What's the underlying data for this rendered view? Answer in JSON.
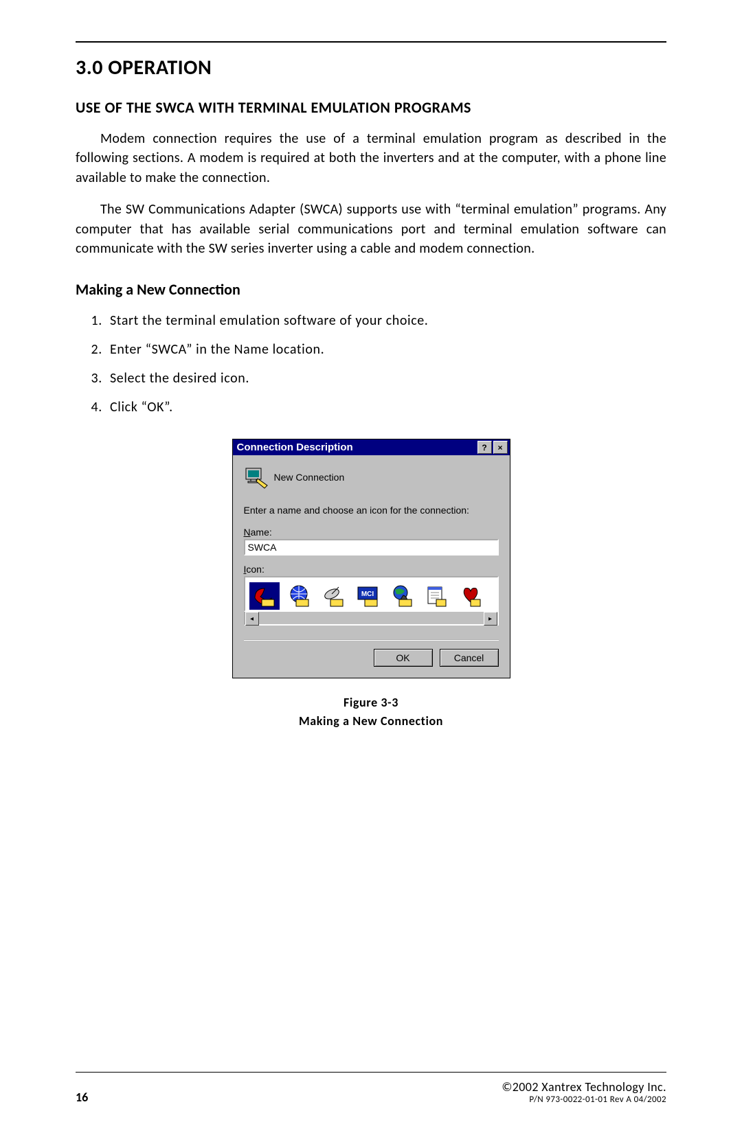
{
  "chapter": {
    "title": "3.0 OPERATION"
  },
  "section": {
    "title": "USE OF THE SWCA WITH TERMINAL EMULATION PROGRAMS"
  },
  "paragraphs": {
    "p1": "Modem connection requires the use of a terminal emulation program as described in the following sections. A modem is required at both the inverters and at the computer, with a phone line available to make the connection.",
    "p2": "The SW Communications Adapter (SWCA) supports use with “terminal emulation” programs.  Any computer that has available serial communications port and terminal emulation software can communicate with the SW series inverter using a cable and modem connection."
  },
  "subsection": {
    "title": "Making a New Connection"
  },
  "steps": [
    "Start the terminal emulation software of your choice.",
    "Enter “SWCA” in the Name location.",
    "Select the desired icon.",
    "Click “OK”."
  ],
  "dialog": {
    "title": "Connection Description",
    "new_connection_label": "New Connection",
    "prompt": "Enter a name and choose an icon for the connection:",
    "name_label_prefix": "N",
    "name_label_suffix": "ame:",
    "name_value": "SWCA",
    "icon_label_prefix": "I",
    "icon_label_suffix": "con:",
    "ok_label": "OK",
    "cancel_label": "Cancel",
    "help_btn": "?",
    "close_btn": "×",
    "scroll_left": "◂",
    "scroll_right": "▸"
  },
  "icons": [
    "phone-modem-icon",
    "globe-lines-icon",
    "satellite-dish-icon",
    "mci-icon",
    "globe-phone-icon",
    "computer-paper-icon",
    "heart-phone-icon"
  ],
  "figure": {
    "number": "Figure 3-3",
    "caption": "Making a New Connection"
  },
  "footer": {
    "page": "16",
    "copyright": "©2002 Xantrex Technology Inc.",
    "partnum": "P/N 973-0022-01-01  Rev A  04/2002"
  }
}
